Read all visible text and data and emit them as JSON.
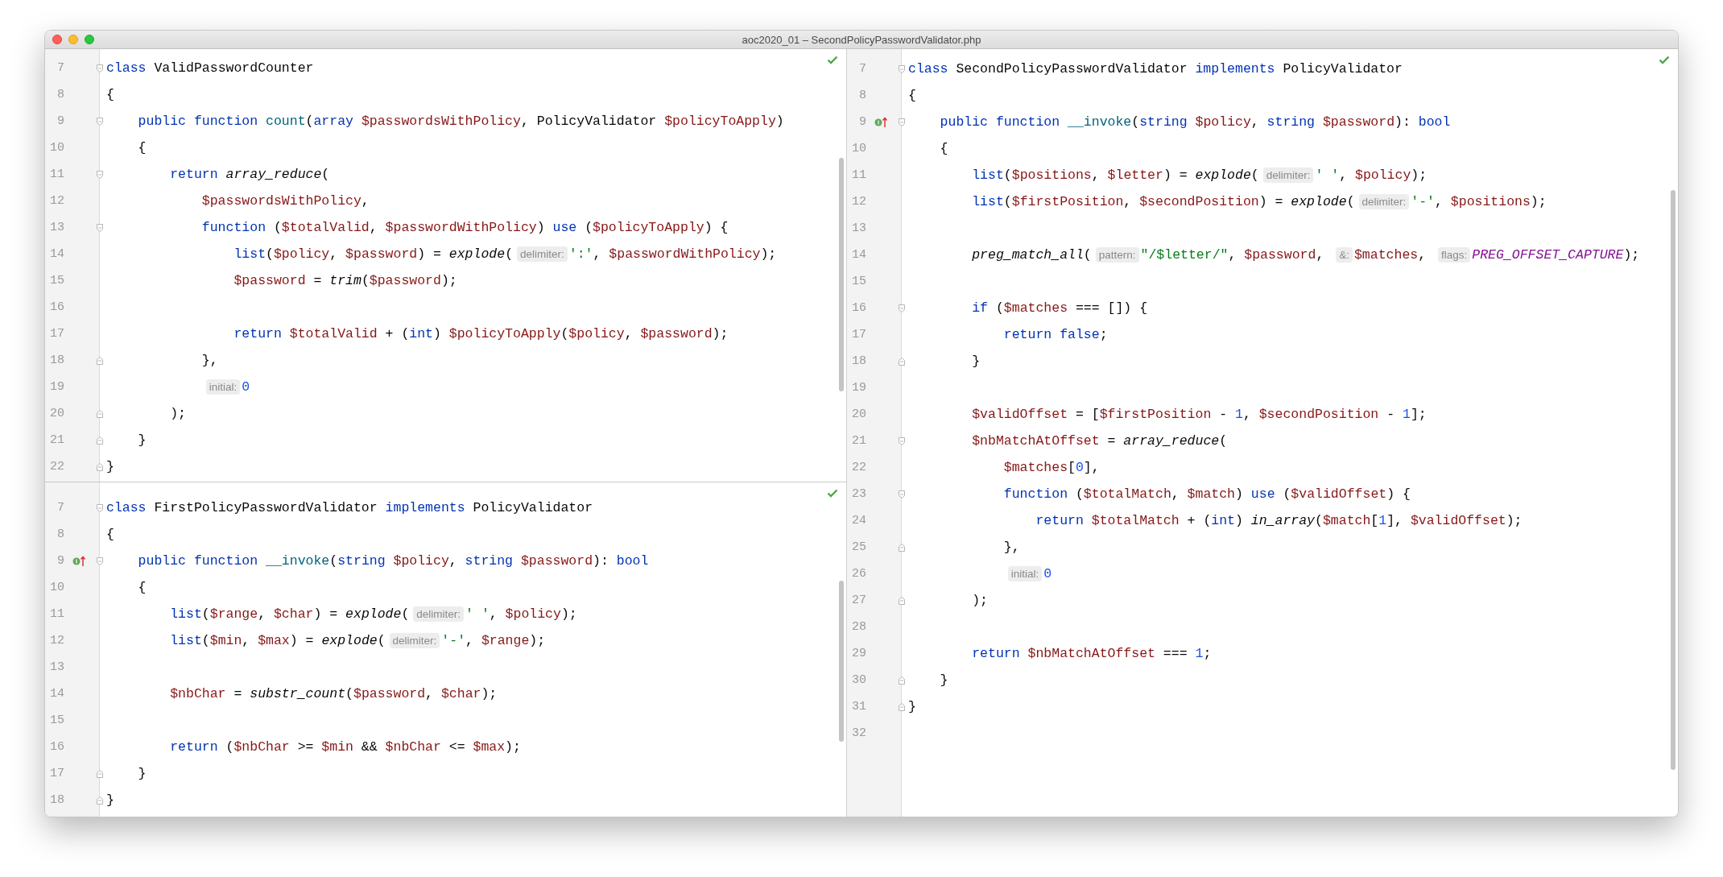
{
  "window": {
    "title": "aoc2020_01 – SecondPolicyPasswordValidator.php"
  },
  "panes": [
    {
      "lines": [
        {
          "number": "7",
          "kind": "fold-start",
          "tokens": [
            {
              "kind": "kw",
              "text": "class"
            },
            {
              "kind": "plain",
              "text": " ValidPasswordCounter"
            }
          ]
        },
        {
          "number": "8",
          "kind": "code",
          "tokens": [
            {
              "kind": "plain",
              "text": "{"
            }
          ]
        },
        {
          "number": "9",
          "kind": "fold-start",
          "tokens": [
            {
              "kind": "kw",
              "text": "    public function "
            },
            {
              "kind": "method",
              "text": "count"
            },
            {
              "kind": "plain",
              "text": "("
            },
            {
              "kind": "kw",
              "text": "array "
            },
            {
              "kind": "var",
              "text": "$passwordsWithPolicy"
            },
            {
              "kind": "plain",
              "text": ", PolicyValidator "
            },
            {
              "kind": "var",
              "text": "$policyToApply"
            },
            {
              "kind": "plain",
              "text": ")"
            }
          ]
        },
        {
          "number": "10",
          "kind": "code",
          "tokens": [
            {
              "kind": "plain",
              "text": "    {"
            }
          ]
        },
        {
          "number": "11",
          "kind": "fold-start",
          "tokens": [
            {
              "kind": "kw",
              "text": "        return "
            },
            {
              "kind": "fn",
              "text": "array_reduce"
            },
            {
              "kind": "plain",
              "text": "("
            }
          ]
        },
        {
          "number": "12",
          "kind": "code",
          "tokens": [
            {
              "kind": "var",
              "text": "            $passwordsWithPolicy"
            },
            {
              "kind": "plain",
              "text": ","
            }
          ]
        },
        {
          "number": "13",
          "kind": "fold-start",
          "tokens": [
            {
              "kind": "kw",
              "text": "            function "
            },
            {
              "kind": "plain",
              "text": "("
            },
            {
              "kind": "var",
              "text": "$totalValid"
            },
            {
              "kind": "plain",
              "text": ", "
            },
            {
              "kind": "var",
              "text": "$passwordWithPolicy"
            },
            {
              "kind": "plain",
              "text": ") "
            },
            {
              "kind": "kw",
              "text": "use"
            },
            {
              "kind": "plain",
              "text": " ("
            },
            {
              "kind": "var",
              "text": "$policyToApply"
            },
            {
              "kind": "plain",
              "text": ") {"
            }
          ]
        },
        {
          "number": "14",
          "kind": "code",
          "tokens": [
            {
              "kind": "kw",
              "text": "                list"
            },
            {
              "kind": "plain",
              "text": "("
            },
            {
              "kind": "var",
              "text": "$policy"
            },
            {
              "kind": "plain",
              "text": ", "
            },
            {
              "kind": "var",
              "text": "$password"
            },
            {
              "kind": "plain",
              "text": ") = "
            },
            {
              "kind": "fn",
              "text": "explode"
            },
            {
              "kind": "plain",
              "text": "("
            },
            {
              "kind": "hint",
              "text": "delimiter:"
            },
            {
              "kind": "str",
              "text": "':'"
            },
            {
              "kind": "plain",
              "text": ", "
            },
            {
              "kind": "var",
              "text": "$passwordWithPolicy"
            },
            {
              "kind": "plain",
              "text": ");"
            }
          ]
        },
        {
          "number": "15",
          "kind": "code",
          "tokens": [
            {
              "kind": "var",
              "text": "                $password"
            },
            {
              "kind": "plain",
              "text": " = "
            },
            {
              "kind": "fn",
              "text": "trim"
            },
            {
              "kind": "plain",
              "text": "("
            },
            {
              "kind": "var",
              "text": "$password"
            },
            {
              "kind": "plain",
              "text": ");"
            }
          ]
        },
        {
          "number": "16",
          "kind": "code"
        },
        {
          "number": "17",
          "kind": "code",
          "tokens": [
            {
              "kind": "kw",
              "text": "                return "
            },
            {
              "kind": "var",
              "text": "$totalValid"
            },
            {
              "kind": "plain",
              "text": " + ("
            },
            {
              "kind": "kw",
              "text": "int"
            },
            {
              "kind": "plain",
              "text": ") "
            },
            {
              "kind": "var",
              "text": "$policyToApply"
            },
            {
              "kind": "plain",
              "text": "("
            },
            {
              "kind": "var",
              "text": "$policy"
            },
            {
              "kind": "plain",
              "text": ", "
            },
            {
              "kind": "var",
              "text": "$password"
            },
            {
              "kind": "plain",
              "text": ");"
            }
          ]
        },
        {
          "number": "18",
          "kind": "fold-end",
          "tokens": [
            {
              "kind": "plain",
              "text": "            },"
            }
          ]
        },
        {
          "number": "19",
          "kind": "code",
          "tokens": [
            {
              "kind": "hint",
              "text": "            initial:"
            },
            {
              "kind": "num",
              "text": "0"
            }
          ]
        },
        {
          "number": "20",
          "kind": "fold-end",
          "tokens": [
            {
              "kind": "plain",
              "text": "        );"
            }
          ]
        },
        {
          "number": "21",
          "kind": "fold-end",
          "tokens": [
            {
              "kind": "plain",
              "text": "    }"
            }
          ]
        },
        {
          "number": "22",
          "kind": "fold-end",
          "tokens": [
            {
              "kind": "plain",
              "text": "}"
            }
          ]
        }
      ]
    },
    {
      "lines": [
        {
          "number": "7",
          "kind": "fold-start",
          "tokens": [
            {
              "kind": "kw",
              "text": "class"
            },
            {
              "kind": "plain",
              "text": " FirstPolicyPasswordValidator "
            },
            {
              "kind": "kw",
              "text": "implements"
            },
            {
              "kind": "plain",
              "text": " PolicyValidator"
            }
          ]
        },
        {
          "number": "8",
          "kind": "code",
          "tokens": [
            {
              "kind": "plain",
              "text": "{"
            }
          ]
        },
        {
          "number": "9",
          "kind": "fold-start",
          "marker": true,
          "tokens": [
            {
              "kind": "kw",
              "text": "    public function "
            },
            {
              "kind": "method",
              "text": "__invoke"
            },
            {
              "kind": "plain",
              "text": "("
            },
            {
              "kind": "kw",
              "text": "string "
            },
            {
              "kind": "var",
              "text": "$policy"
            },
            {
              "kind": "plain",
              "text": ", "
            },
            {
              "kind": "kw",
              "text": "string "
            },
            {
              "kind": "var",
              "text": "$password"
            },
            {
              "kind": "plain",
              "text": "): "
            },
            {
              "kind": "kw",
              "text": "bool"
            }
          ]
        },
        {
          "number": "10",
          "kind": "code",
          "tokens": [
            {
              "kind": "plain",
              "text": "    {"
            }
          ]
        },
        {
          "number": "11",
          "kind": "code",
          "tokens": [
            {
              "kind": "kw",
              "text": "        list"
            },
            {
              "kind": "plain",
              "text": "("
            },
            {
              "kind": "var",
              "text": "$range"
            },
            {
              "kind": "plain",
              "text": ", "
            },
            {
              "kind": "var",
              "text": "$char"
            },
            {
              "kind": "plain",
              "text": ") = "
            },
            {
              "kind": "fn",
              "text": "explode"
            },
            {
              "kind": "plain",
              "text": "("
            },
            {
              "kind": "hint",
              "text": "delimiter:"
            },
            {
              "kind": "str",
              "text": "' '"
            },
            {
              "kind": "plain",
              "text": ", "
            },
            {
              "kind": "var",
              "text": "$policy"
            },
            {
              "kind": "plain",
              "text": ");"
            }
          ]
        },
        {
          "number": "12",
          "kind": "code",
          "tokens": [
            {
              "kind": "kw",
              "text": "        list"
            },
            {
              "kind": "plain",
              "text": "("
            },
            {
              "kind": "var",
              "text": "$min"
            },
            {
              "kind": "plain",
              "text": ", "
            },
            {
              "kind": "var",
              "text": "$max"
            },
            {
              "kind": "plain",
              "text": ") = "
            },
            {
              "kind": "fn",
              "text": "explode"
            },
            {
              "kind": "plain",
              "text": "("
            },
            {
              "kind": "hint",
              "text": "delimiter:"
            },
            {
              "kind": "str",
              "text": "'-'"
            },
            {
              "kind": "plain",
              "text": ", "
            },
            {
              "kind": "var",
              "text": "$range"
            },
            {
              "kind": "plain",
              "text": ");"
            }
          ]
        },
        {
          "number": "13",
          "kind": "code"
        },
        {
          "number": "14",
          "kind": "code",
          "tokens": [
            {
              "kind": "var",
              "text": "        $nbChar"
            },
            {
              "kind": "plain",
              "text": " = "
            },
            {
              "kind": "fn",
              "text": "substr_count"
            },
            {
              "kind": "plain",
              "text": "("
            },
            {
              "kind": "var",
              "text": "$password"
            },
            {
              "kind": "plain",
              "text": ", "
            },
            {
              "kind": "var",
              "text": "$char"
            },
            {
              "kind": "plain",
              "text": ");"
            }
          ]
        },
        {
          "number": "15",
          "kind": "code"
        },
        {
          "number": "16",
          "kind": "code",
          "tokens": [
            {
              "kind": "kw",
              "text": "        return"
            },
            {
              "kind": "plain",
              "text": " ("
            },
            {
              "kind": "var",
              "text": "$nbChar"
            },
            {
              "kind": "plain",
              "text": " >= "
            },
            {
              "kind": "var",
              "text": "$min"
            },
            {
              "kind": "plain",
              "text": " && "
            },
            {
              "kind": "var",
              "text": "$nbChar"
            },
            {
              "kind": "plain",
              "text": " <= "
            },
            {
              "kind": "var",
              "text": "$max"
            },
            {
              "kind": "plain",
              "text": ");"
            }
          ]
        },
        {
          "number": "17",
          "kind": "fold-end",
          "tokens": [
            {
              "kind": "plain",
              "text": "    }"
            }
          ]
        },
        {
          "number": "18",
          "kind": "fold-end",
          "tokens": [
            {
              "kind": "plain",
              "text": "}"
            }
          ]
        }
      ]
    },
    {
      "lines": [
        {
          "number": "7",
          "kind": "fold-start",
          "tokens": [
            {
              "kind": "kw",
              "text": "class"
            },
            {
              "kind": "plain",
              "text": " SecondPolicyPasswordValidator "
            },
            {
              "kind": "kw",
              "text": "implements"
            },
            {
              "kind": "plain",
              "text": " PolicyValidator"
            }
          ]
        },
        {
          "number": "8",
          "kind": "code",
          "tokens": [
            {
              "kind": "plain",
              "text": "{"
            }
          ]
        },
        {
          "number": "9",
          "kind": "fold-start",
          "marker": true,
          "tokens": [
            {
              "kind": "kw",
              "text": "    public function "
            },
            {
              "kind": "method",
              "text": "__invoke"
            },
            {
              "kind": "plain",
              "text": "("
            },
            {
              "kind": "kw",
              "text": "string "
            },
            {
              "kind": "var",
              "text": "$policy"
            },
            {
              "kind": "plain",
              "text": ", "
            },
            {
              "kind": "kw",
              "text": "string "
            },
            {
              "kind": "var",
              "text": "$password"
            },
            {
              "kind": "plain",
              "text": "): "
            },
            {
              "kind": "kw",
              "text": "bool"
            }
          ]
        },
        {
          "number": "10",
          "kind": "code",
          "tokens": [
            {
              "kind": "plain",
              "text": "    {"
            }
          ]
        },
        {
          "number": "11",
          "kind": "code",
          "tokens": [
            {
              "kind": "kw",
              "text": "        list"
            },
            {
              "kind": "plain",
              "text": "("
            },
            {
              "kind": "var",
              "text": "$positions"
            },
            {
              "kind": "plain",
              "text": ", "
            },
            {
              "kind": "var",
              "text": "$letter"
            },
            {
              "kind": "plain",
              "text": ") = "
            },
            {
              "kind": "fn",
              "text": "explode"
            },
            {
              "kind": "plain",
              "text": "("
            },
            {
              "kind": "hint",
              "text": "delimiter:"
            },
            {
              "kind": "str",
              "text": "' '"
            },
            {
              "kind": "plain",
              "text": ", "
            },
            {
              "kind": "var",
              "text": "$policy"
            },
            {
              "kind": "plain",
              "text": ");"
            }
          ]
        },
        {
          "number": "12",
          "kind": "code",
          "tokens": [
            {
              "kind": "kw",
              "text": "        list"
            },
            {
              "kind": "plain",
              "text": "("
            },
            {
              "kind": "var",
              "text": "$firstPosition"
            },
            {
              "kind": "plain",
              "text": ", "
            },
            {
              "kind": "var",
              "text": "$secondPosition"
            },
            {
              "kind": "plain",
              "text": ") = "
            },
            {
              "kind": "fn",
              "text": "explode"
            },
            {
              "kind": "plain",
              "text": "("
            },
            {
              "kind": "hint",
              "text": "delimiter:"
            },
            {
              "kind": "str",
              "text": "'-'"
            },
            {
              "kind": "plain",
              "text": ", "
            },
            {
              "kind": "var",
              "text": "$positions"
            },
            {
              "kind": "plain",
              "text": ");"
            }
          ]
        },
        {
          "number": "13",
          "kind": "code"
        },
        {
          "number": "14",
          "kind": "code",
          "tokens": [
            {
              "kind": "fn",
              "text": "        preg_match_all"
            },
            {
              "kind": "plain",
              "text": "("
            },
            {
              "kind": "hint",
              "text": "pattern:"
            },
            {
              "kind": "str",
              "text": "\"/$letter/\""
            },
            {
              "kind": "plain",
              "text": ", "
            },
            {
              "kind": "var",
              "text": "$password"
            },
            {
              "kind": "plain",
              "text": ", "
            },
            {
              "kind": "hint",
              "text": "&:"
            },
            {
              "kind": "var",
              "text": "$matches"
            },
            {
              "kind": "plain",
              "text": ", "
            },
            {
              "kind": "hint",
              "text": "flags:"
            },
            {
              "kind": "const",
              "text": "PREG_OFFSET_CAPTURE"
            },
            {
              "kind": "plain",
              "text": ");"
            }
          ]
        },
        {
          "number": "15",
          "kind": "code"
        },
        {
          "number": "16",
          "kind": "fold-start",
          "tokens": [
            {
              "kind": "kw",
              "text": "        if"
            },
            {
              "kind": "plain",
              "text": " ("
            },
            {
              "kind": "var",
              "text": "$matches"
            },
            {
              "kind": "plain",
              "text": " === []) {"
            }
          ]
        },
        {
          "number": "17",
          "kind": "code",
          "tokens": [
            {
              "kind": "kw",
              "text": "            return false"
            },
            {
              "kind": "plain",
              "text": ";"
            }
          ]
        },
        {
          "number": "18",
          "kind": "fold-end",
          "tokens": [
            {
              "kind": "plain",
              "text": "        }"
            }
          ]
        },
        {
          "number": "19",
          "kind": "code"
        },
        {
          "number": "20",
          "kind": "code",
          "tokens": [
            {
              "kind": "var",
              "text": "        $validOffset"
            },
            {
              "kind": "plain",
              "text": " = ["
            },
            {
              "kind": "var",
              "text": "$firstPosition"
            },
            {
              "kind": "plain",
              "text": " - "
            },
            {
              "kind": "num",
              "text": "1"
            },
            {
              "kind": "plain",
              "text": ", "
            },
            {
              "kind": "var",
              "text": "$secondPosition"
            },
            {
              "kind": "plain",
              "text": " - "
            },
            {
              "kind": "num",
              "text": "1"
            },
            {
              "kind": "plain",
              "text": "];"
            }
          ]
        },
        {
          "number": "21",
          "kind": "fold-start",
          "tokens": [
            {
              "kind": "var",
              "text": "        $nbMatchAtOffset"
            },
            {
              "kind": "plain",
              "text": " = "
            },
            {
              "kind": "fn",
              "text": "array_reduce"
            },
            {
              "kind": "plain",
              "text": "("
            }
          ]
        },
        {
          "number": "22",
          "kind": "code",
          "tokens": [
            {
              "kind": "var",
              "text": "            $matches"
            },
            {
              "kind": "plain",
              "text": "["
            },
            {
              "kind": "num",
              "text": "0"
            },
            {
              "kind": "plain",
              "text": "],"
            }
          ]
        },
        {
          "number": "23",
          "kind": "fold-start",
          "tokens": [
            {
              "kind": "kw",
              "text": "            function"
            },
            {
              "kind": "plain",
              "text": " ("
            },
            {
              "kind": "var",
              "text": "$totalMatch"
            },
            {
              "kind": "plain",
              "text": ", "
            },
            {
              "kind": "var",
              "text": "$match"
            },
            {
              "kind": "plain",
              "text": ") "
            },
            {
              "kind": "kw",
              "text": "use"
            },
            {
              "kind": "plain",
              "text": " ("
            },
            {
              "kind": "var",
              "text": "$validOffset"
            },
            {
              "kind": "plain",
              "text": ") {"
            }
          ]
        },
        {
          "number": "24",
          "kind": "code",
          "tokens": [
            {
              "kind": "kw",
              "text": "                return "
            },
            {
              "kind": "var",
              "text": "$totalMatch"
            },
            {
              "kind": "plain",
              "text": " + ("
            },
            {
              "kind": "kw",
              "text": "int"
            },
            {
              "kind": "plain",
              "text": ") "
            },
            {
              "kind": "fn",
              "text": "in_array"
            },
            {
              "kind": "plain",
              "text": "("
            },
            {
              "kind": "var",
              "text": "$match"
            },
            {
              "kind": "plain",
              "text": "["
            },
            {
              "kind": "num",
              "text": "1"
            },
            {
              "kind": "plain",
              "text": "], "
            },
            {
              "kind": "var",
              "text": "$validOffset"
            },
            {
              "kind": "plain",
              "text": ");"
            }
          ]
        },
        {
          "number": "25",
          "kind": "fold-end",
          "tokens": [
            {
              "kind": "plain",
              "text": "            },"
            }
          ]
        },
        {
          "number": "26",
          "kind": "code",
          "tokens": [
            {
              "kind": "hint",
              "text": "            initial:"
            },
            {
              "kind": "num",
              "text": "0"
            }
          ]
        },
        {
          "number": "27",
          "kind": "fold-end",
          "tokens": [
            {
              "kind": "plain",
              "text": "        );"
            }
          ]
        },
        {
          "number": "28",
          "kind": "code"
        },
        {
          "number": "29",
          "kind": "code",
          "tokens": [
            {
              "kind": "kw",
              "text": "        return "
            },
            {
              "kind": "var",
              "text": "$nbMatchAtOffset"
            },
            {
              "kind": "plain",
              "text": " === "
            },
            {
              "kind": "num",
              "text": "1"
            },
            {
              "kind": "plain",
              "text": ";"
            }
          ]
        },
        {
          "number": "30",
          "kind": "fold-end",
          "tokens": [
            {
              "kind": "plain",
              "text": "    }"
            }
          ]
        },
        {
          "number": "31",
          "kind": "fold-end",
          "tokens": [
            {
              "kind": "plain",
              "text": "}"
            }
          ]
        },
        {
          "number": "32",
          "kind": "code"
        }
      ]
    }
  ]
}
